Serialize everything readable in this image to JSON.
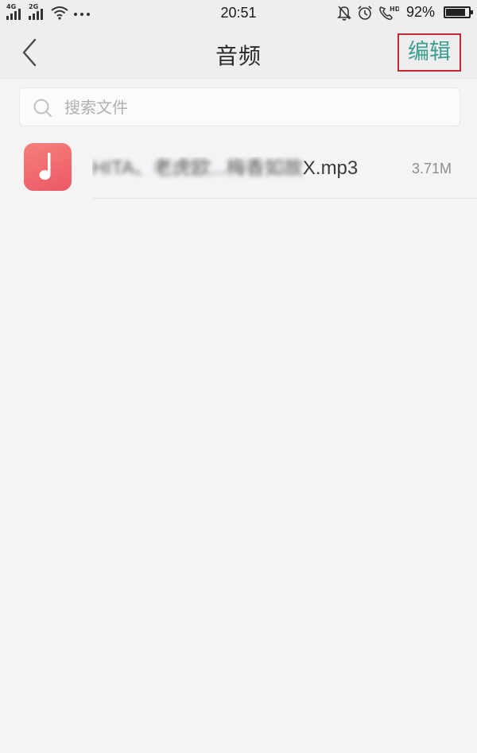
{
  "status_bar": {
    "signal_1_type": "4G",
    "signal_2_type": "2G",
    "time": "20:51",
    "battery_percent": "92%",
    "battery_level": 0.92,
    "icons": [
      "wifi-icon",
      "more-dots-icon",
      "mute-bell-icon",
      "alarm-icon",
      "hd-call-icon",
      "battery-icon"
    ]
  },
  "nav": {
    "title": "音频",
    "edit_label": "编辑",
    "accent_color": "#3aa08e",
    "highlight_color": "#c52a2a"
  },
  "search": {
    "placeholder": "搜索文件",
    "value": ""
  },
  "files": [
    {
      "name_blurred": "HITA、老虎欧...梅香如故",
      "name_suffix": "X.mp3",
      "size": "3.71M",
      "icon": "music-note-icon"
    }
  ]
}
